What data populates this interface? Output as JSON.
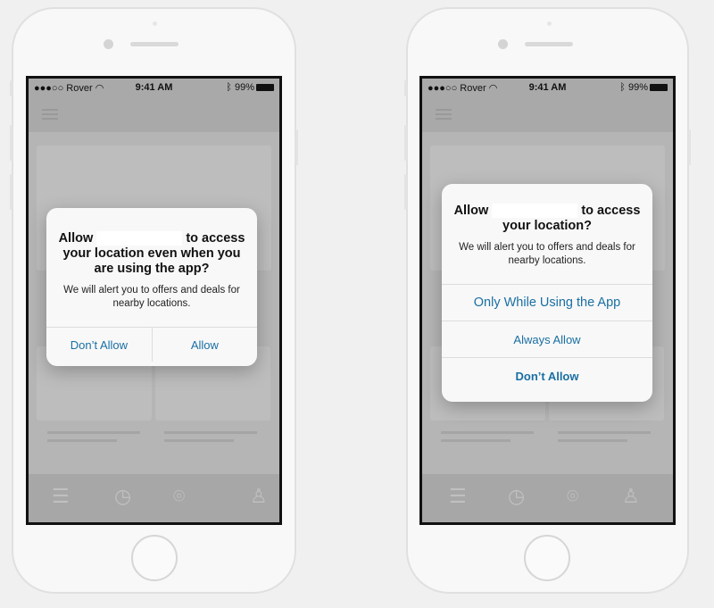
{
  "status": {
    "carrier": "Rover",
    "time": "9:41 AM",
    "battery": "99%"
  },
  "dialog1": {
    "title_pre": "Allow",
    "title_post": "to access your location even when you are using the app?",
    "message": "We will alert you to offers and deals for nearby locations.",
    "deny": "Don’t Allow",
    "allow": "Allow"
  },
  "dialog2": {
    "title_pre": "Allow",
    "title_post": "to access your location?",
    "message": "We will alert you to offers and deals for nearby locations.",
    "option1": "Only While Using the App",
    "option2": "Always Allow",
    "option3": "Don’t Allow"
  },
  "colors": {
    "button_text": "#1a6fa3",
    "dim_overlay": "#b5b5b5"
  }
}
